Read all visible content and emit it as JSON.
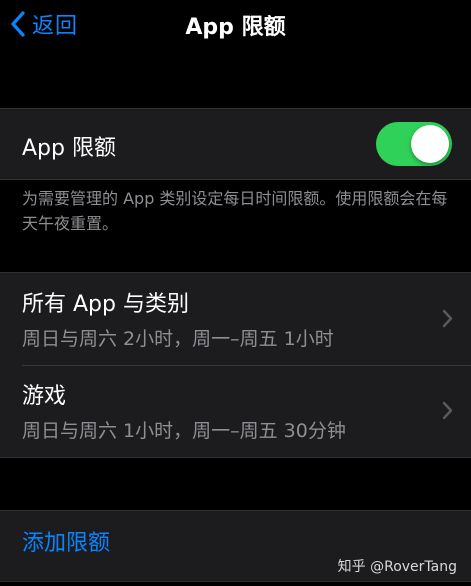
{
  "nav": {
    "back_label": "返回",
    "title": "App 限额"
  },
  "toggle": {
    "label": "App 限额",
    "state": "on",
    "on_color": "#30d158"
  },
  "footer_note": "为需要管理的 App 类别设定每日时间限额。使用限额会在每天午夜重置。",
  "limits": [
    {
      "title": "所有 App 与类别",
      "schedule": "周日与周六 2小时，周一–周五 1小时"
    },
    {
      "title": "游戏",
      "schedule": "周日与周六 1小时，周一–周五 30分钟"
    }
  ],
  "add_limit_label": "添加限额",
  "watermark": "知乎 @RoverTang",
  "colors": {
    "accent": "#0a84ff",
    "background": "#000000",
    "cell": "#1c1c1e",
    "secondary_text": "#8e8e93"
  }
}
